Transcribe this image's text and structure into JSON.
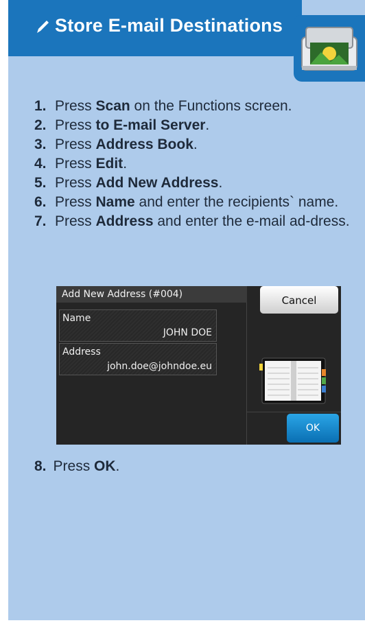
{
  "header": {
    "title": "Store E-mail Destinations"
  },
  "steps": [
    {
      "num": "1.",
      "pre": "Press ",
      "bold": "Scan",
      "post": " on the Functions screen."
    },
    {
      "num": "2.",
      "pre": "Press ",
      "bold": "to E-mail Server",
      "post": "."
    },
    {
      "num": "3.",
      "pre": "Press ",
      "bold": "Address Book",
      "post": "."
    },
    {
      "num": "4.",
      "pre": "Press ",
      "bold": "Edit",
      "post": "."
    },
    {
      "num": "5.",
      "pre": "Press ",
      "bold": "Add New Address",
      "post": "."
    },
    {
      "num": "6.",
      "pre": "Press ",
      "bold": "Name",
      "post": " and enter the recipients` name."
    },
    {
      "num": "7.",
      "pre": "Press ",
      "bold": "Address",
      "post": " and enter the e-mail ad-dress."
    }
  ],
  "screen": {
    "title": "Add New Address (#004)",
    "cancel_label": "Cancel",
    "name_label": "Name",
    "name_value": "JOHN DOE",
    "address_label": "Address",
    "address_value": "john.doe@johndoe.eu",
    "ok_label": "OK"
  },
  "step8": {
    "num": "8.",
    "pre": "Press ",
    "bold": "OK",
    "post": "."
  },
  "colors": {
    "header_blue": "#1b75bc",
    "card_bg": "#aecbeb",
    "ok_blue": "#1a8bd0"
  },
  "icons": [
    "checkmark-icon",
    "scanner-icon",
    "address-book-icon"
  ]
}
